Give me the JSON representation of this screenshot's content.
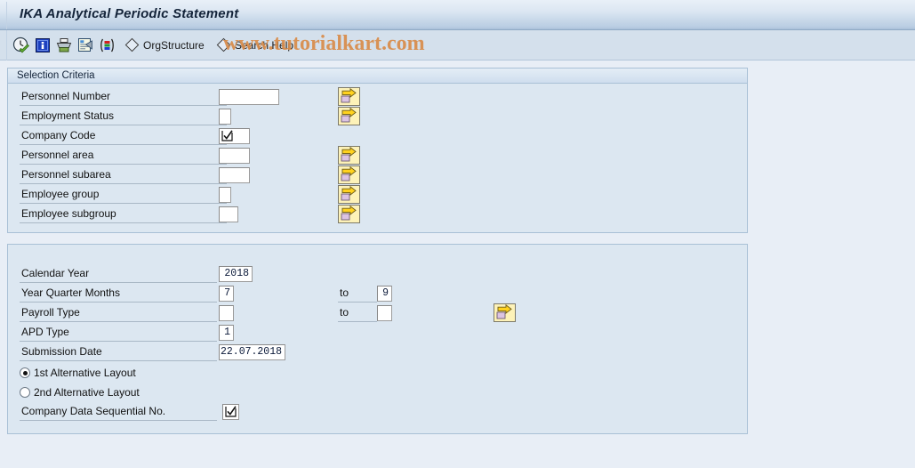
{
  "window": {
    "title": "IKA Analytical Periodic Statement"
  },
  "toolbar": {
    "icons": [
      {
        "name": "execute-clock-icon"
      },
      {
        "name": "information-icon"
      },
      {
        "name": "print-icon"
      },
      {
        "name": "variant-icon"
      },
      {
        "name": "colors-icon"
      }
    ],
    "buttons": [
      {
        "name": "org-structure-button",
        "label": "OrgStructure"
      },
      {
        "name": "search-help-button",
        "label": "Search Help"
      }
    ]
  },
  "watermark": {
    "text": "www.tutorialkart.com",
    "color": "#d98c4a"
  },
  "selection_criteria": {
    "header": "Selection Criteria",
    "rows": [
      {
        "label": "Personnel Number",
        "value": "",
        "field_width": 68,
        "has_arrow": true,
        "checkbox": false
      },
      {
        "label": "Employment Status",
        "value": "",
        "field_width": 14,
        "has_arrow": true,
        "checkbox": false
      },
      {
        "label": "Company Code",
        "value": "",
        "field_width": 35,
        "has_arrow": false,
        "checkbox": true
      },
      {
        "label": "Personnel area",
        "value": "",
        "field_width": 35,
        "has_arrow": true,
        "checkbox": false
      },
      {
        "label": "Personnel subarea",
        "value": "",
        "field_width": 35,
        "has_arrow": true,
        "checkbox": false
      },
      {
        "label": "Employee group",
        "value": "",
        "field_width": 14,
        "has_arrow": true,
        "checkbox": false
      },
      {
        "label": "Employee subgroup",
        "value": "",
        "field_width": 22,
        "has_arrow": true,
        "checkbox": false
      }
    ]
  },
  "parameters": {
    "rows": [
      {
        "label": "Calendar Year",
        "value": "2018",
        "field_width": 38,
        "to_label": "",
        "to_value": "",
        "to_width": 0,
        "has_arrow": false
      },
      {
        "label": "Year Quarter Months",
        "value": "7",
        "field_width": 17,
        "to_label": "to",
        "to_value": "9",
        "to_width": 17,
        "has_arrow": false
      },
      {
        "label": "Payroll Type",
        "value": "",
        "field_width": 17,
        "to_label": "to",
        "to_value": "",
        "to_width": 17,
        "has_arrow": true
      },
      {
        "label": "APD Type",
        "value": "1",
        "field_width": 17,
        "to_label": "",
        "to_value": "",
        "to_width": 0,
        "has_arrow": false
      },
      {
        "label": "Submission Date",
        "value": "22.07.2018",
        "field_width": 75,
        "to_label": "",
        "to_value": "",
        "to_width": 0,
        "has_arrow": false
      }
    ],
    "radios": [
      {
        "label": "1st Alternative Layout",
        "selected": true
      },
      {
        "label": "2nd Alternative Layout",
        "selected": false
      }
    ],
    "checkbox_row": {
      "label": "Company Data Sequential No.",
      "checked": true
    }
  }
}
